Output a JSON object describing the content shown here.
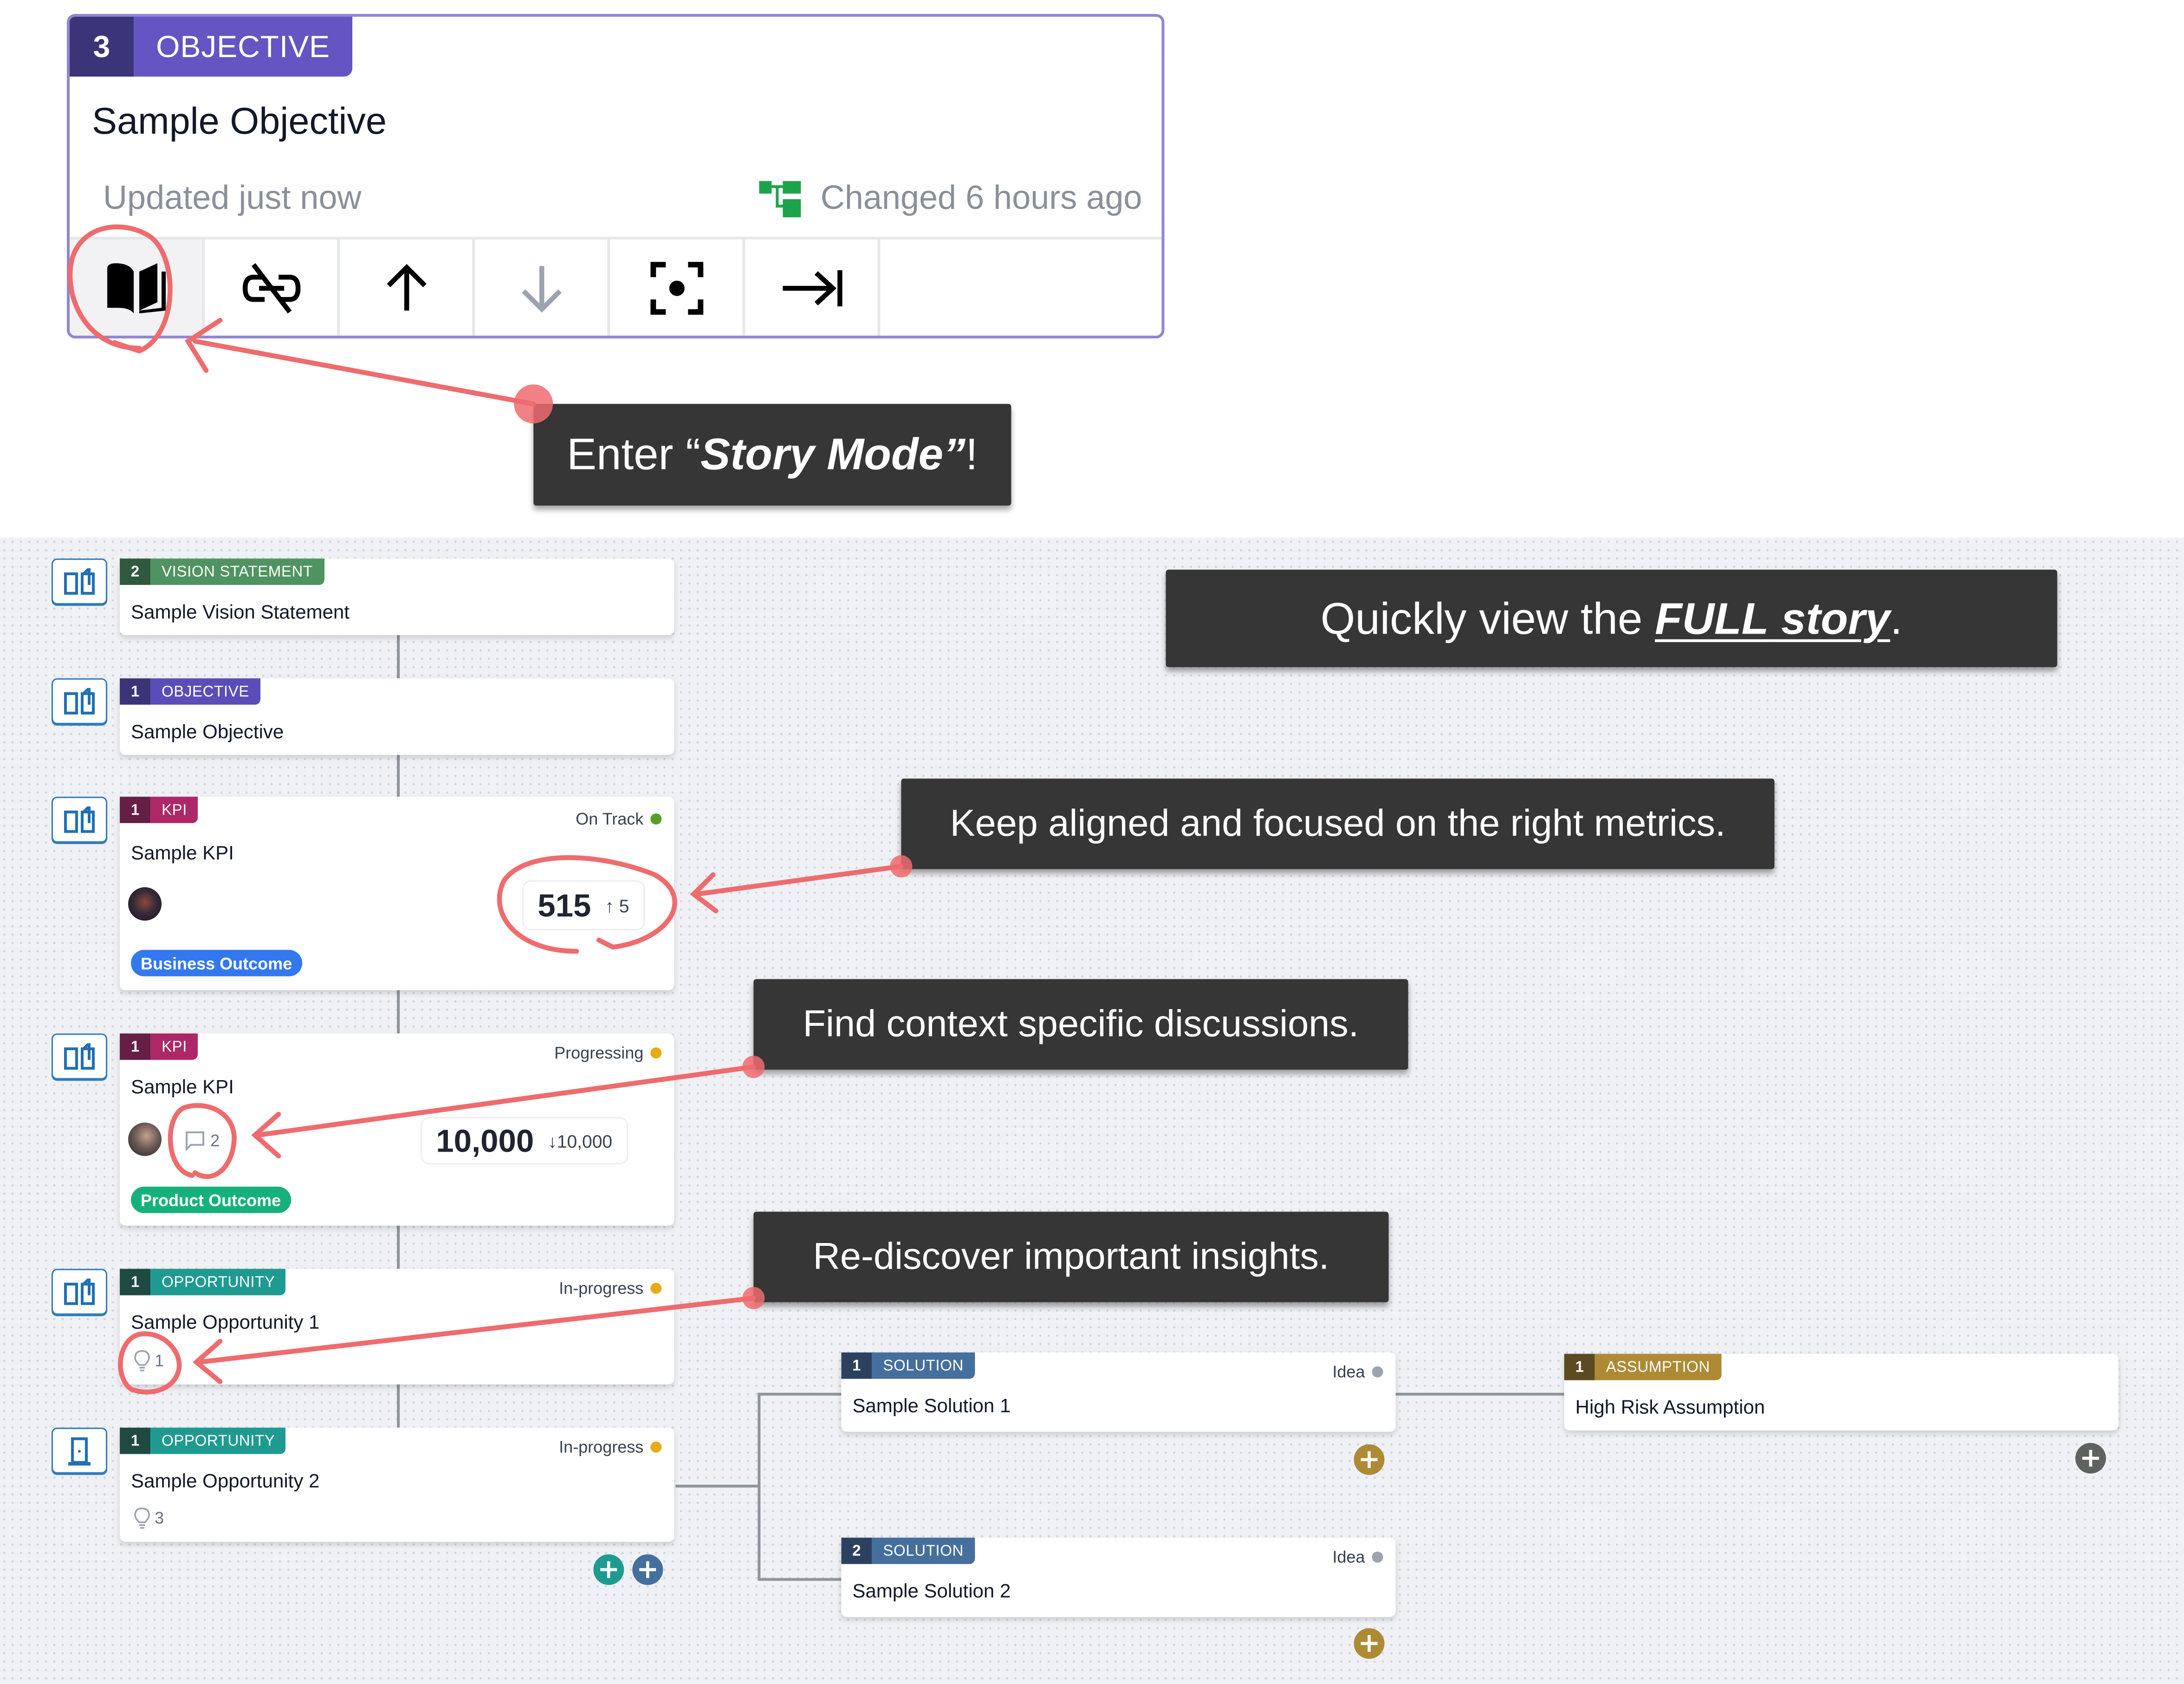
{
  "top_card": {
    "tag_number": "3",
    "tag_label": "OBJECTIVE",
    "title": "Sample Objective",
    "updated": "Updated just now",
    "changed": "Changed 6 hours ago",
    "actions": [
      {
        "name": "story-mode",
        "icon": "open-book-icon"
      },
      {
        "name": "unlink",
        "icon": "unlink-icon"
      },
      {
        "name": "move-up",
        "icon": "arrow-up-icon"
      },
      {
        "name": "move-down",
        "icon": "arrow-down-icon"
      },
      {
        "name": "focus",
        "icon": "focus-icon"
      },
      {
        "name": "go-to-end",
        "icon": "arrow-right-to-bar-icon"
      }
    ]
  },
  "callouts": {
    "story_prefix": "Enter “",
    "story_emphasis": "Story Mode”",
    "story_suffix": "!",
    "full_prefix": "Quickly view the ",
    "full_emphasis": "FULL",
    "full_story": "story",
    "full_suffix": ".",
    "metrics": "Keep aligned and focused on the right metrics.",
    "discussions": "Find context specific discussions.",
    "insights": "Re-discover important insights."
  },
  "colors": {
    "annotation_red": "#ee6b6e",
    "callout_bg": "#363636",
    "objective": "#6455c2",
    "vision": "#4f9460",
    "kpi": "#ae2766",
    "opportunity": "#1f9a91",
    "solution": "#456f9c",
    "assumption": "#ae8a35",
    "on_track": "#56a02a",
    "progressing": "#e5ac16",
    "idea": "#9ca3af"
  },
  "nodes": {
    "vision": {
      "number": "2",
      "type": "VISION STATEMENT",
      "title": "Sample Vision Statement"
    },
    "objective": {
      "number": "1",
      "type": "OBJECTIVE",
      "title": "Sample Objective"
    },
    "kpi1": {
      "number": "1",
      "type": "KPI",
      "title": "Sample KPI",
      "status": "On Track",
      "value": "515",
      "delta": "5",
      "delta_dir": "up",
      "outcome": "Business Outcome"
    },
    "kpi2": {
      "number": "1",
      "type": "KPI",
      "title": "Sample KPI",
      "status": "Progressing",
      "value": "10,000",
      "delta": "10,000",
      "delta_dir": "down",
      "comments": "2",
      "outcome": "Product Outcome"
    },
    "opp1": {
      "number": "1",
      "type": "OPPORTUNITY",
      "title": "Sample Opportunity 1",
      "status": "In-progress",
      "insights": "1"
    },
    "opp2": {
      "number": "1",
      "type": "OPPORTUNITY",
      "title": "Sample Opportunity 2",
      "status": "In-progress",
      "insights": "3"
    },
    "sol1": {
      "number": "1",
      "type": "SOLUTION",
      "title": "Sample Solution 1",
      "status": "Idea"
    },
    "sol2": {
      "number": "2",
      "type": "SOLUTION",
      "title": "Sample Solution 2",
      "status": "Idea"
    },
    "assumption": {
      "number": "1",
      "type": "ASSUMPTION",
      "title": "High Risk Assumption"
    }
  }
}
